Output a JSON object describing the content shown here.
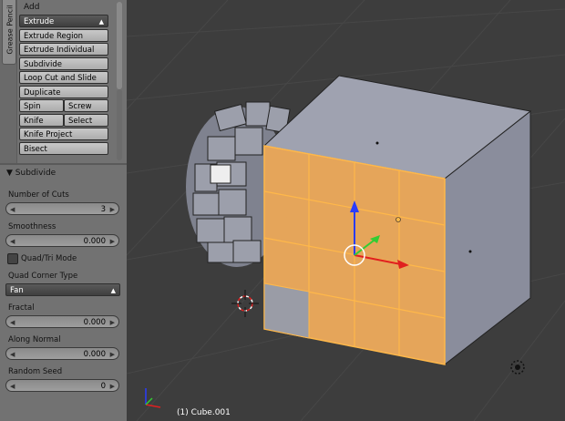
{
  "toolshelf": {
    "tab_label": "Grease Pencil",
    "add_header": "Add",
    "extrude_dropdown": "Extrude",
    "buttons": {
      "extrude_region": "Extrude Region",
      "extrude_individual": "Extrude Individual",
      "subdivide": "Subdivide",
      "loop_cut": "Loop Cut and Slide",
      "duplicate": "Duplicate",
      "spin": "Spin",
      "screw": "Screw",
      "knife": "Knife",
      "select": "Select",
      "knife_project": "Knife Project",
      "bisect": "Bisect"
    }
  },
  "operator_panel": {
    "title": "Subdivide",
    "number_of_cuts_label": "Number of Cuts",
    "number_of_cuts_value": "3",
    "smoothness_label": "Smoothness",
    "smoothness_value": "0.000",
    "quad_tri_label": "Quad/Tri Mode",
    "quad_corner_label": "Quad Corner Type",
    "quad_corner_value": "Fan",
    "fractal_label": "Fractal",
    "fractal_value": "0.000",
    "along_normal_label": "Along Normal",
    "along_normal_value": "0.000",
    "random_seed_label": "Random Seed",
    "random_seed_value": "0"
  },
  "viewport": {
    "status": "(1) Cube.001"
  },
  "colors": {
    "selected_face": "#e5a55a",
    "edge_highlight": "#ffb84a",
    "cube_side": "#8a8d9c",
    "viewport_bg": "#3d3d3d"
  }
}
